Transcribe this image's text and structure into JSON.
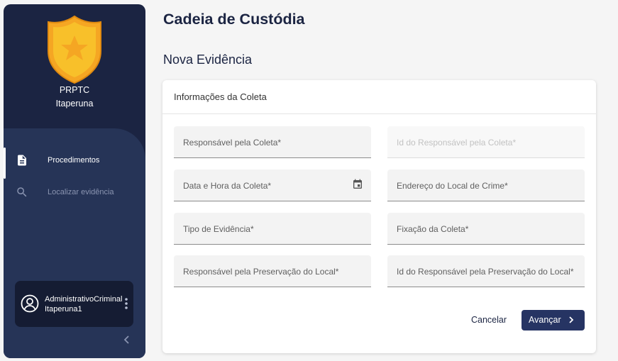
{
  "app": {
    "org_name": "PRPTC",
    "org_city": "Itaperuna",
    "logo_icon": "police-badge-star-icon",
    "colors": {
      "sidebar": "#1b2442",
      "nav_panel": "#263457",
      "accent": "#263463",
      "badge_gold": "#f2b014"
    }
  },
  "sidebar": {
    "items": [
      {
        "label": "Procedimentos",
        "icon": "document-icon",
        "active": true
      },
      {
        "label": "Localizar evidência",
        "icon": "search-icon",
        "active": false
      }
    ],
    "user": {
      "name": "AdministrativoCriminalItaperuna1",
      "icon": "account-circle-icon",
      "menu_icon": "kebab-menu-icon"
    },
    "collapse_icon": "chevron-left-icon"
  },
  "page": {
    "title": "Cadeia de Custódia",
    "subtitle": "Nova Evidência"
  },
  "form": {
    "section_title": "Informações da Coleta",
    "fields": [
      {
        "label": "Responsável pela Coleta*",
        "value": "",
        "disabled": false
      },
      {
        "label": "Id do Responsável pela Coleta*",
        "value": "",
        "disabled": true
      },
      {
        "label": "Data e Hora da Coleta*",
        "value": "",
        "disabled": false,
        "icon": "calendar-icon"
      },
      {
        "label": "Endereço do Local de Crime*",
        "value": "",
        "disabled": false
      },
      {
        "label": "Tipo de Evidência*",
        "value": "",
        "disabled": false
      },
      {
        "label": "Fixação da Coleta*",
        "value": "",
        "disabled": false
      },
      {
        "label": "Responsável pela Preservação do Local*",
        "value": "",
        "disabled": false
      },
      {
        "label": "Id do Responsável pela Preservação do Local*",
        "value": "",
        "disabled": false
      }
    ],
    "cancel_label": "Cancelar",
    "next_label": "Avançar"
  }
}
